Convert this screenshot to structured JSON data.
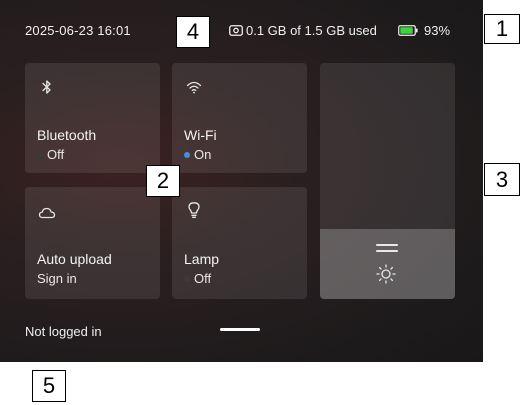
{
  "status": {
    "datetime": "2025-06-23  16:01",
    "storage_text": "0.1 GB of 1.5 GB used",
    "battery_text": "93%",
    "battery_level": 0.93,
    "battery_color": "#3fd43f"
  },
  "tiles": {
    "bluetooth": {
      "label": "Bluetooth",
      "state": "Off",
      "icon": "bluetooth-icon"
    },
    "wifi": {
      "label": "Wi-Fi",
      "state": "On",
      "icon": "wifi-icon",
      "state_color": "#3d8fe8"
    },
    "auto_upload": {
      "label": "Auto upload",
      "state": "Sign in",
      "icon": "cloud-icon"
    },
    "lamp": {
      "label": "Lamp",
      "state": "Off",
      "icon": "lightbulb-icon"
    }
  },
  "brightness": {
    "level": 0.19,
    "icon": "sun-icon"
  },
  "footer": {
    "login_status": "Not logged in"
  },
  "markers": [
    "1",
    "2",
    "3",
    "4",
    "5"
  ]
}
